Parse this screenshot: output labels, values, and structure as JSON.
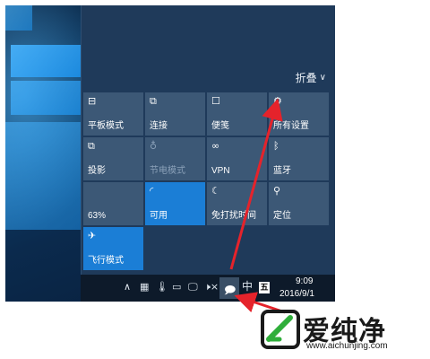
{
  "action_center": {
    "collapse_label": "折叠",
    "collapse_icon": "chevron-down-icon",
    "tiles": [
      {
        "label": "平板模式",
        "icon": "tablet-mode-icon",
        "glyph": "⊟",
        "active": false,
        "dim": false
      },
      {
        "label": "连接",
        "icon": "connect-icon",
        "glyph": "⧉",
        "active": false,
        "dim": false
      },
      {
        "label": "便笺",
        "icon": "note-icon",
        "glyph": "☐",
        "active": false,
        "dim": false
      },
      {
        "label": "所有设置",
        "icon": "gear-icon",
        "glyph": "⚙",
        "active": false,
        "dim": false
      },
      {
        "label": "投影",
        "icon": "project-icon",
        "glyph": "⧉",
        "active": false,
        "dim": false
      },
      {
        "label": "节电模式",
        "icon": "battery-saver-icon",
        "glyph": "♁",
        "active": false,
        "dim": true
      },
      {
        "label": "VPN",
        "icon": "vpn-icon",
        "glyph": "∞",
        "active": false,
        "dim": false
      },
      {
        "label": "蓝牙",
        "icon": "bluetooth-icon",
        "glyph": "ᛒ",
        "active": false,
        "dim": false
      },
      {
        "label": "63%",
        "icon": "brightness-icon",
        "glyph": "",
        "active": false,
        "dim": false
      },
      {
        "label": "可用",
        "icon": "wifi-icon",
        "glyph": "◜",
        "active": true,
        "dim": false
      },
      {
        "label": "免打扰时间",
        "icon": "moon-icon",
        "glyph": "☾",
        "active": false,
        "dim": false
      },
      {
        "label": "定位",
        "icon": "location-icon",
        "glyph": "⚲",
        "active": false,
        "dim": false
      },
      {
        "label": "飞行模式",
        "icon": "airplane-icon",
        "glyph": "✈",
        "active": true,
        "dim": false
      }
    ]
  },
  "taskbar": {
    "tray": [
      {
        "name": "show-hidden-icons-icon",
        "glyph": "∧"
      },
      {
        "name": "keyboard-icon",
        "glyph": "▦"
      },
      {
        "name": "thermometer-icon",
        "glyph": "🌡"
      },
      {
        "name": "battery-icon",
        "glyph": "▭"
      },
      {
        "name": "network-icon",
        "glyph": "🖵"
      },
      {
        "name": "volume-muted-icon",
        "glyph": "🕨×"
      }
    ],
    "notification_glyph": "🗩",
    "ime_label": "中",
    "ime_box_label": "五",
    "time": "9:09",
    "date": "2016/9/1"
  },
  "watermark": {
    "text": "爱纯净",
    "url": "www.aichunjing.com"
  },
  "colors": {
    "accent": "#1b7ed6",
    "arrow": "#e5232b",
    "tile": "#3c5876",
    "panel": "#1f3a5a"
  }
}
